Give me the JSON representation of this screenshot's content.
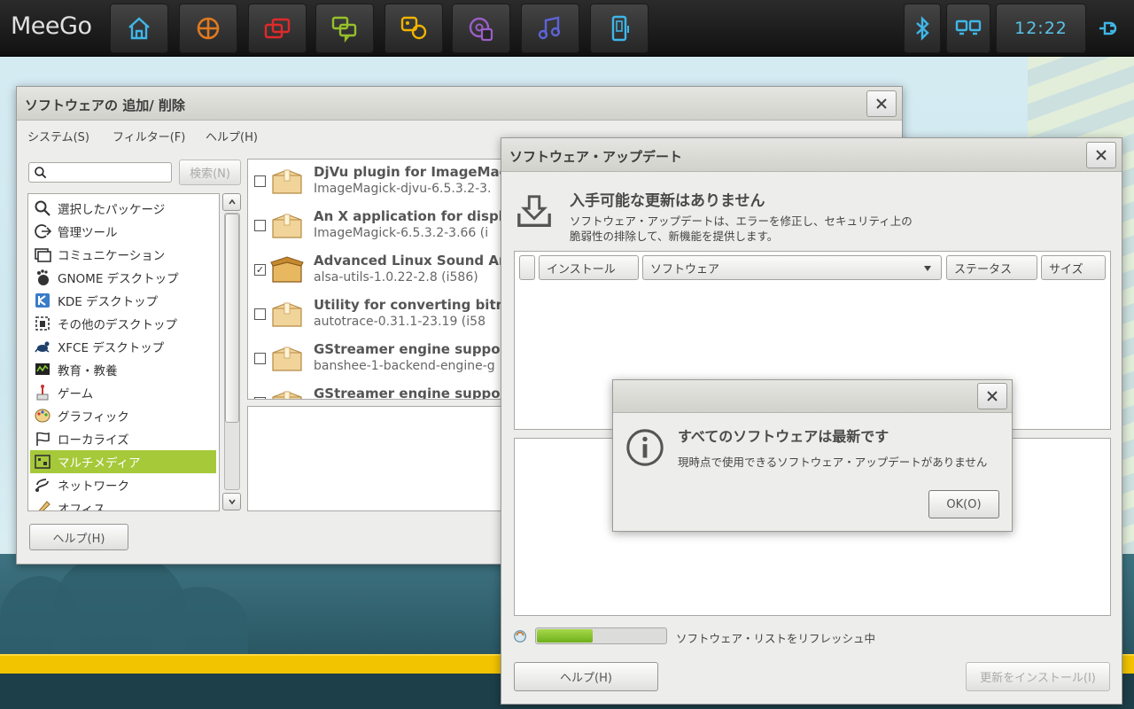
{
  "topbar": {
    "logo": "MeeGo",
    "clock": "12:22"
  },
  "software_window": {
    "title": "ソフトウェアの 追加/ 削除",
    "menu": [
      "システム(S)",
      "フィルター(F)",
      "ヘルプ(H)"
    ],
    "search_placeholder": "",
    "search_button": "検索(N)",
    "categories": [
      {
        "label": "選択したパッケージ",
        "icon": "search-icon"
      },
      {
        "label": "管理ツール",
        "icon": "admin-icon"
      },
      {
        "label": "コミュニケーション",
        "icon": "communication-icon"
      },
      {
        "label": "GNOME デスクトップ",
        "icon": "gnome-icon"
      },
      {
        "label": "KDE デスクトップ",
        "icon": "kde-icon"
      },
      {
        "label": "その他のデスクトップ",
        "icon": "desktop-icon"
      },
      {
        "label": "XFCE デスクトップ",
        "icon": "xfce-icon"
      },
      {
        "label": "教育・教養",
        "icon": "education-icon"
      },
      {
        "label": "ゲーム",
        "icon": "game-icon"
      },
      {
        "label": "グラフィック",
        "icon": "graphics-icon"
      },
      {
        "label": "ローカライズ",
        "icon": "flag-icon"
      },
      {
        "label": "マルチメディア",
        "icon": "multimedia-icon"
      },
      {
        "label": "ネットワーク",
        "icon": "network-icon"
      },
      {
        "label": "オフィス",
        "icon": "office-icon"
      }
    ],
    "selected_category": "マルチメディア",
    "packages": [
      {
        "name": "DjVu plugin for ImageMag",
        "version": "ImageMagick-djvu-6.5.3.2-3.",
        "checked": false
      },
      {
        "name": "An X application for displa",
        "version": "ImageMagick-6.5.3.2-3.66 (i",
        "checked": false
      },
      {
        "name": "Advanced Linux Sound Arc",
        "version": "alsa-utils-1.0.22-2.8 (i586)",
        "checked": true
      },
      {
        "name": "Utility for converting bitm",
        "version": "autotrace-0.31.1-23.19 (i58",
        "checked": false
      },
      {
        "name": "GStreamer engine support",
        "version": "banshee-1-backend-engine-g",
        "checked": false
      },
      {
        "name": "GStreamer engine support",
        "version": "",
        "checked": false
      }
    ],
    "help_button": "ヘルプ(H)"
  },
  "update_window": {
    "title": "ソフトウェア・アップデート",
    "heading": "入手可能な更新はありません",
    "description_line1": "ソフトウェア・アップデートは、エラーを修正し、セキュリティ上の",
    "description_line2": "脆弱性の排除して、新機能を提供します。",
    "columns": {
      "install": "インストール",
      "software": "ソフトウェア",
      "status": "ステータス",
      "size": "サイズ"
    },
    "progress_fraction": 0.43,
    "status_text": "ソフトウェア・リストをリフレッシュ中",
    "help_button": "ヘルプ(H)",
    "install_button": "更新をインストール(I)"
  },
  "dialog": {
    "heading": "すべてのソフトウェアは最新です",
    "message": "現時点で使用できるソフトウェア・アップデートがありません",
    "ok_button": "OK(O)"
  },
  "colors": {
    "accent_green": "#a6c93a",
    "clock_blue": "#59c4ea"
  }
}
